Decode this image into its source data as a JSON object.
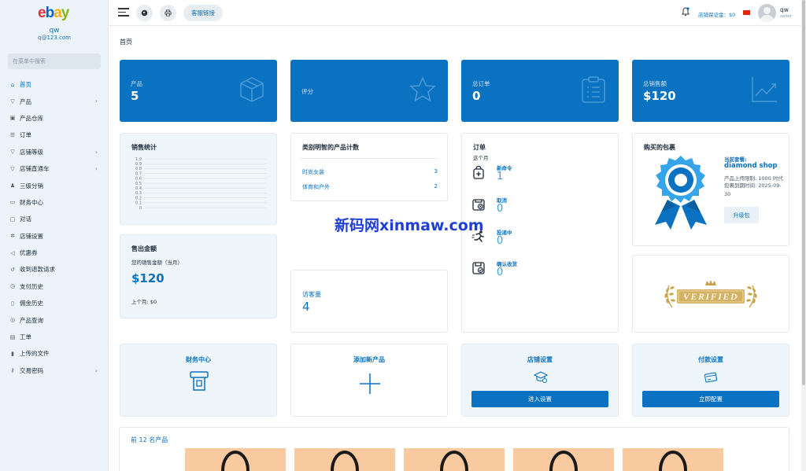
{
  "sidebar": {
    "logo": [
      "e",
      "b",
      "a",
      "y"
    ],
    "logo_colors": [
      "#e53238",
      "#0064d2",
      "#f5af02",
      "#86b817"
    ],
    "user_name": "qw",
    "user_email": "q@123.com",
    "search_placeholder": "在菜单中搜索",
    "items": [
      {
        "label": "首页",
        "icon": "home-icon",
        "active": true,
        "expandable": false
      },
      {
        "label": "产品",
        "icon": "cart-icon",
        "active": false,
        "expandable": true
      },
      {
        "label": "产品仓库",
        "icon": "warehouse-icon",
        "active": false,
        "expandable": false
      },
      {
        "label": "订单",
        "icon": "order-icon",
        "active": false,
        "expandable": false
      },
      {
        "label": "店铺等级",
        "icon": "cart-icon",
        "active": false,
        "expandable": true
      },
      {
        "label": "店铺直通车",
        "icon": "cart-icon",
        "active": false,
        "expandable": true
      },
      {
        "label": "三级分销",
        "icon": "users-icon",
        "active": false,
        "expandable": false
      },
      {
        "label": "财务中心",
        "icon": "finance-icon",
        "active": false,
        "expandable": false
      },
      {
        "label": "对话",
        "icon": "chat-icon",
        "active": false,
        "expandable": false
      },
      {
        "label": "店铺设置",
        "icon": "gear-icon",
        "active": false,
        "expandable": false
      },
      {
        "label": "优惠券",
        "icon": "megaphone-icon",
        "active": false,
        "expandable": false
      },
      {
        "label": "收到退款请求",
        "icon": "refund-icon",
        "active": false,
        "expandable": false
      },
      {
        "label": "支付历史",
        "icon": "history-icon",
        "active": false,
        "expandable": false
      },
      {
        "label": "佣金历史",
        "icon": "file-icon",
        "active": false,
        "expandable": false
      },
      {
        "label": "产品查询",
        "icon": "query-icon",
        "active": false,
        "expandable": false
      },
      {
        "label": "工单",
        "icon": "ticket-icon",
        "active": false,
        "expandable": false
      },
      {
        "label": "上传的文件",
        "icon": "upload-icon",
        "active": false,
        "expandable": false
      },
      {
        "label": "交易密码",
        "icon": "key-icon",
        "active": false,
        "expandable": true
      }
    ]
  },
  "topbar": {
    "support_label": "客服链接",
    "deposit_label": "店铺保证金：$0",
    "user_name": "qw",
    "user_role": "seller"
  },
  "breadcrumb": "首页",
  "stats": [
    {
      "label": "产品",
      "value": "5",
      "icon": "box-icon"
    },
    {
      "label": "评分",
      "value": "",
      "icon": "star-icon"
    },
    {
      "label": "总订单",
      "value": "0",
      "icon": "clipboard-icon"
    },
    {
      "label": "总销售额",
      "value": "$120",
      "icon": "trend-chart-icon"
    }
  ],
  "sales_stats": {
    "title": "销售统计",
    "chart_data": {
      "type": "line",
      "y_ticks": [
        "1.0",
        "0.9",
        "0.8",
        "0.7",
        "0.6",
        "0.5",
        "0.4",
        "0.3",
        "0.2",
        "0.1",
        "0"
      ],
      "ylim": [
        0,
        1
      ],
      "series": []
    }
  },
  "category_count": {
    "title": "类别明智的产品计数",
    "rows": [
      {
        "name": "时尚女装",
        "count": "3"
      },
      {
        "name": "体育和户外",
        "count": "2"
      }
    ]
  },
  "orders": {
    "title": "订单",
    "subtitle": "这个月",
    "items": [
      {
        "label": "新命令",
        "value": "1",
        "icon": "new-order-icon"
      },
      {
        "label": "取消",
        "value": "0",
        "icon": "cancel-order-icon"
      },
      {
        "label": "投递中",
        "value": "0",
        "icon": "delivery-runner-icon"
      },
      {
        "label": "确认收货",
        "value": "0",
        "icon": "confirm-receipt-icon"
      }
    ]
  },
  "package": {
    "title": "购买的包裹",
    "current_label": "当前套餐:",
    "current_name": "diamond shop",
    "upload_limit": "产品上传限制: 1000 时代",
    "expire": "包裹到期时间: 2025-09-30",
    "upgrade_label": "升级包"
  },
  "verified": {
    "badge_text": "VERIFIED"
  },
  "sold_amount": {
    "title": "售出金额",
    "sub": "您的销售金额（当月）",
    "value": "$120",
    "last_month": "上个月: $0"
  },
  "visitors": {
    "label": "访客量",
    "value": "4"
  },
  "actions": [
    {
      "title": "财务中心",
      "icon": "finance-center-icon",
      "button": ""
    },
    {
      "title": "添加新产品",
      "icon": "plus-icon",
      "button": ""
    },
    {
      "title": "店铺设置",
      "icon": "shop-settings-icon",
      "button": "进入设置"
    },
    {
      "title": "付款设置",
      "icon": "payment-card-icon",
      "button": "立即配置"
    }
  ],
  "top_products": {
    "title": "前 12 名产品"
  },
  "watermark": "新码网xinmaw.com",
  "colors": {
    "primary": "#0b72c2",
    "light_bg": "#eef5fb",
    "sidebar_bg": "#ecf3fa"
  }
}
